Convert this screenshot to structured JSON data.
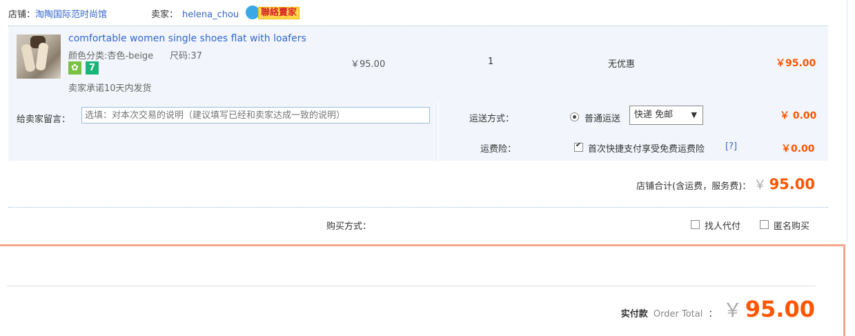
{
  "shop": {
    "label": "店铺：",
    "name": "淘陶国际范时尚馆",
    "seller_label": "卖家：",
    "seller_name": "helena_chou",
    "contact_badge": "聯絡賣家"
  },
  "item": {
    "title": "comfortable women single shoes flat with loafers",
    "color_attr": "颜色分类:杏色-beige",
    "size_attr": "尺码:37",
    "badge2": "7",
    "promise": "卖家承诺10天内发货",
    "unit_price": "￥95.00",
    "quantity": "1",
    "discount": "无优惠",
    "subtotal": "￥95.00"
  },
  "message": {
    "label": "给卖家留言：",
    "placeholder": "选填：对本次交易的说明（建议填写已经和卖家达成一致的说明）"
  },
  "shipping": {
    "label": "运送方式：",
    "option": "普通运送",
    "select_value": "快递 免邮",
    "fee": "￥ 0.00",
    "insurance_label": "运费险：",
    "insurance_text": "首次快捷支付享受免费运费险",
    "insurance_help": "[?]",
    "insurance_fee": "￥0.00"
  },
  "shop_total": {
    "label": "店铺合计(含运费，服务费)：",
    "currency": "￥",
    "amount": "95.00"
  },
  "purchase": {
    "label": "购买方式：",
    "option1": "找人代付",
    "option2": "匿名购买"
  },
  "order_total": {
    "label_cn": "实付款",
    "label_en": "Order Total",
    "colon": "：",
    "currency": "￥",
    "amount": "95.00"
  },
  "colors": {
    "accent": "#ff5500",
    "link": "#3366cc",
    "row_bg": "#f2f6fc",
    "highlight_border": "#f8a58a"
  }
}
